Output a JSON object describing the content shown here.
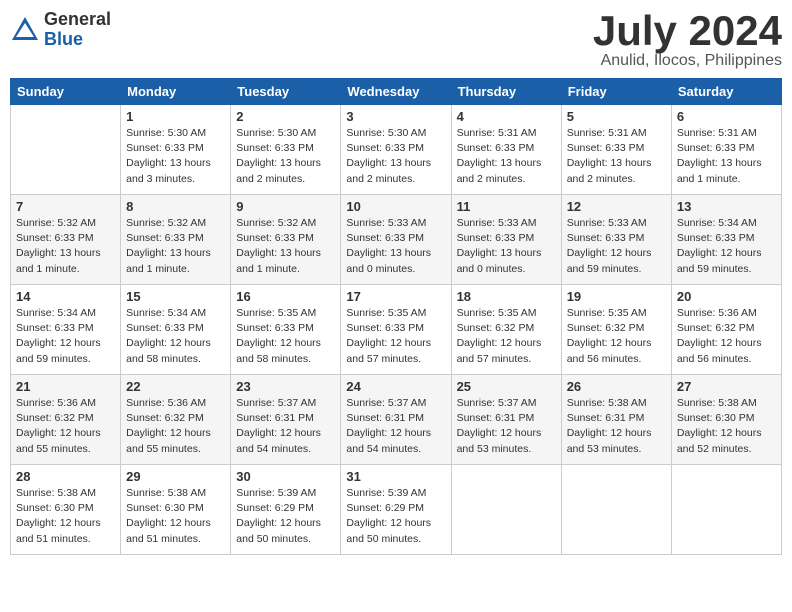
{
  "logo": {
    "general": "General",
    "blue": "Blue"
  },
  "title": "July 2024",
  "location": "Anulid, Ilocos, Philippines",
  "days_of_week": [
    "Sunday",
    "Monday",
    "Tuesday",
    "Wednesday",
    "Thursday",
    "Friday",
    "Saturday"
  ],
  "weeks": [
    [
      {
        "day": "",
        "sunrise": "",
        "sunset": "",
        "daylight": ""
      },
      {
        "day": "1",
        "sunrise": "Sunrise: 5:30 AM",
        "sunset": "Sunset: 6:33 PM",
        "daylight": "Daylight: 13 hours and 3 minutes."
      },
      {
        "day": "2",
        "sunrise": "Sunrise: 5:30 AM",
        "sunset": "Sunset: 6:33 PM",
        "daylight": "Daylight: 13 hours and 2 minutes."
      },
      {
        "day": "3",
        "sunrise": "Sunrise: 5:30 AM",
        "sunset": "Sunset: 6:33 PM",
        "daylight": "Daylight: 13 hours and 2 minutes."
      },
      {
        "day": "4",
        "sunrise": "Sunrise: 5:31 AM",
        "sunset": "Sunset: 6:33 PM",
        "daylight": "Daylight: 13 hours and 2 minutes."
      },
      {
        "day": "5",
        "sunrise": "Sunrise: 5:31 AM",
        "sunset": "Sunset: 6:33 PM",
        "daylight": "Daylight: 13 hours and 2 minutes."
      },
      {
        "day": "6",
        "sunrise": "Sunrise: 5:31 AM",
        "sunset": "Sunset: 6:33 PM",
        "daylight": "Daylight: 13 hours and 1 minute."
      }
    ],
    [
      {
        "day": "7",
        "sunrise": "Sunrise: 5:32 AM",
        "sunset": "Sunset: 6:33 PM",
        "daylight": "Daylight: 13 hours and 1 minute."
      },
      {
        "day": "8",
        "sunrise": "Sunrise: 5:32 AM",
        "sunset": "Sunset: 6:33 PM",
        "daylight": "Daylight: 13 hours and 1 minute."
      },
      {
        "day": "9",
        "sunrise": "Sunrise: 5:32 AM",
        "sunset": "Sunset: 6:33 PM",
        "daylight": "Daylight: 13 hours and 1 minute."
      },
      {
        "day": "10",
        "sunrise": "Sunrise: 5:33 AM",
        "sunset": "Sunset: 6:33 PM",
        "daylight": "Daylight: 13 hours and 0 minutes."
      },
      {
        "day": "11",
        "sunrise": "Sunrise: 5:33 AM",
        "sunset": "Sunset: 6:33 PM",
        "daylight": "Daylight: 13 hours and 0 minutes."
      },
      {
        "day": "12",
        "sunrise": "Sunrise: 5:33 AM",
        "sunset": "Sunset: 6:33 PM",
        "daylight": "Daylight: 12 hours and 59 minutes."
      },
      {
        "day": "13",
        "sunrise": "Sunrise: 5:34 AM",
        "sunset": "Sunset: 6:33 PM",
        "daylight": "Daylight: 12 hours and 59 minutes."
      }
    ],
    [
      {
        "day": "14",
        "sunrise": "Sunrise: 5:34 AM",
        "sunset": "Sunset: 6:33 PM",
        "daylight": "Daylight: 12 hours and 59 minutes."
      },
      {
        "day": "15",
        "sunrise": "Sunrise: 5:34 AM",
        "sunset": "Sunset: 6:33 PM",
        "daylight": "Daylight: 12 hours and 58 minutes."
      },
      {
        "day": "16",
        "sunrise": "Sunrise: 5:35 AM",
        "sunset": "Sunset: 6:33 PM",
        "daylight": "Daylight: 12 hours and 58 minutes."
      },
      {
        "day": "17",
        "sunrise": "Sunrise: 5:35 AM",
        "sunset": "Sunset: 6:33 PM",
        "daylight": "Daylight: 12 hours and 57 minutes."
      },
      {
        "day": "18",
        "sunrise": "Sunrise: 5:35 AM",
        "sunset": "Sunset: 6:32 PM",
        "daylight": "Daylight: 12 hours and 57 minutes."
      },
      {
        "day": "19",
        "sunrise": "Sunrise: 5:35 AM",
        "sunset": "Sunset: 6:32 PM",
        "daylight": "Daylight: 12 hours and 56 minutes."
      },
      {
        "day": "20",
        "sunrise": "Sunrise: 5:36 AM",
        "sunset": "Sunset: 6:32 PM",
        "daylight": "Daylight: 12 hours and 56 minutes."
      }
    ],
    [
      {
        "day": "21",
        "sunrise": "Sunrise: 5:36 AM",
        "sunset": "Sunset: 6:32 PM",
        "daylight": "Daylight: 12 hours and 55 minutes."
      },
      {
        "day": "22",
        "sunrise": "Sunrise: 5:36 AM",
        "sunset": "Sunset: 6:32 PM",
        "daylight": "Daylight: 12 hours and 55 minutes."
      },
      {
        "day": "23",
        "sunrise": "Sunrise: 5:37 AM",
        "sunset": "Sunset: 6:31 PM",
        "daylight": "Daylight: 12 hours and 54 minutes."
      },
      {
        "day": "24",
        "sunrise": "Sunrise: 5:37 AM",
        "sunset": "Sunset: 6:31 PM",
        "daylight": "Daylight: 12 hours and 54 minutes."
      },
      {
        "day": "25",
        "sunrise": "Sunrise: 5:37 AM",
        "sunset": "Sunset: 6:31 PM",
        "daylight": "Daylight: 12 hours and 53 minutes."
      },
      {
        "day": "26",
        "sunrise": "Sunrise: 5:38 AM",
        "sunset": "Sunset: 6:31 PM",
        "daylight": "Daylight: 12 hours and 53 minutes."
      },
      {
        "day": "27",
        "sunrise": "Sunrise: 5:38 AM",
        "sunset": "Sunset: 6:30 PM",
        "daylight": "Daylight: 12 hours and 52 minutes."
      }
    ],
    [
      {
        "day": "28",
        "sunrise": "Sunrise: 5:38 AM",
        "sunset": "Sunset: 6:30 PM",
        "daylight": "Daylight: 12 hours and 51 minutes."
      },
      {
        "day": "29",
        "sunrise": "Sunrise: 5:38 AM",
        "sunset": "Sunset: 6:30 PM",
        "daylight": "Daylight: 12 hours and 51 minutes."
      },
      {
        "day": "30",
        "sunrise": "Sunrise: 5:39 AM",
        "sunset": "Sunset: 6:29 PM",
        "daylight": "Daylight: 12 hours and 50 minutes."
      },
      {
        "day": "31",
        "sunrise": "Sunrise: 5:39 AM",
        "sunset": "Sunset: 6:29 PM",
        "daylight": "Daylight: 12 hours and 50 minutes."
      },
      {
        "day": "",
        "sunrise": "",
        "sunset": "",
        "daylight": ""
      },
      {
        "day": "",
        "sunrise": "",
        "sunset": "",
        "daylight": ""
      },
      {
        "day": "",
        "sunrise": "",
        "sunset": "",
        "daylight": ""
      }
    ]
  ]
}
